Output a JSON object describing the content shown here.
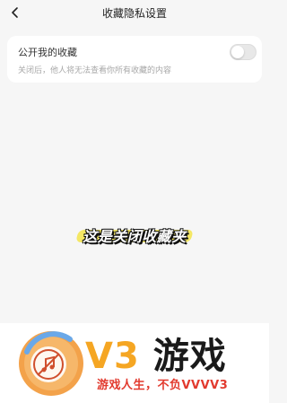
{
  "header": {
    "title": "收藏隐私设置",
    "back_icon": "chevron-left-icon"
  },
  "setting": {
    "label": "公开我的收藏",
    "description": "关闭后，他人将无法查看你所有收藏的内容",
    "toggle_on": false
  },
  "caption": {
    "text": "这是关闭收藏夹",
    "highlight_color": "#f3e44a"
  },
  "watermark": {
    "brand": "V3",
    "brand_cn": "游戏",
    "slogan": "游戏人生，不负VVVV3",
    "brand_color": "#f5a623",
    "slogan_color": "#e23a2e",
    "logo_icon": "music-disc-logo-icon"
  }
}
